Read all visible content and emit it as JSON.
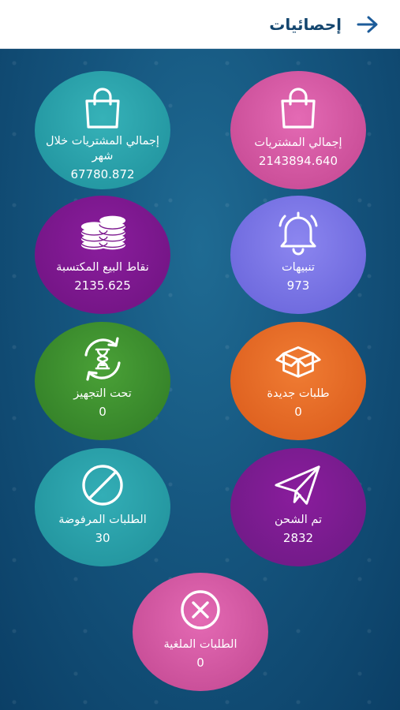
{
  "header": {
    "title": "إحصائيات",
    "back_icon": "arrow-right-icon",
    "accent": "#13456e"
  },
  "stats": [
    {
      "id": "total_purchases",
      "label": "إجمالي المشتريات",
      "value": "2143894.640",
      "icon": "shopping-bag-icon",
      "color": "#d457a3"
    },
    {
      "id": "monthly_purchases",
      "label": "إجمالي المشتريات خلال شهر",
      "value": "67780.872",
      "icon": "shopping-bag-icon",
      "color": "#29a1ab"
    },
    {
      "id": "notifications",
      "label": "تنبيهات",
      "value": "973",
      "icon": "bell-icon",
      "color": "#7873e6"
    },
    {
      "id": "earned_points",
      "label": "نقاط البيع المكتسبة",
      "value": "2135.625",
      "icon": "coins-icon",
      "color": "#7c178e"
    },
    {
      "id": "new_orders",
      "label": "طلبات جديدة",
      "value": "0",
      "icon": "box-icon",
      "color": "#e66a26"
    },
    {
      "id": "in_preparation",
      "label": "تحت التجهيز",
      "value": "0",
      "icon": "hourglass-cycle-icon",
      "color": "#3d8e2e"
    },
    {
      "id": "shipped",
      "label": "تم الشحن",
      "value": "2832",
      "icon": "paper-plane-icon",
      "color": "#7c178e"
    },
    {
      "id": "rejected_orders",
      "label": "الطلبات المرفوضة",
      "value": "30",
      "icon": "prohibited-icon",
      "color": "#29a1ab"
    },
    {
      "id": "cancelled_orders",
      "label": "الطلبات الملغية",
      "value": "0",
      "icon": "x-circle-icon",
      "color": "#d457a3"
    }
  ]
}
